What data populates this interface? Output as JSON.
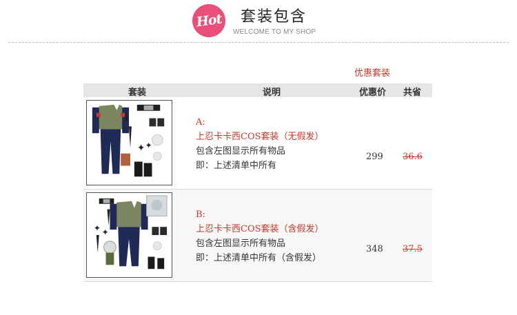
{
  "header": {
    "badge_text": "Hot",
    "title": "套装包含",
    "subtitle": "WELCOME TO MY SHOP"
  },
  "promo_label": "优惠套装",
  "table": {
    "columns": [
      "套装",
      "说明",
      "优惠价",
      "共省"
    ],
    "rows": [
      {
        "option": "A:",
        "name": "上忍卡卡西COS套装（无假发）",
        "line1": "包含左图显示所有物品",
        "line2": "即：上述清单中所有",
        "price": "299",
        "saving": "36.6"
      },
      {
        "option": "B:",
        "name": "上忍卡卡西COS套装（含假发）",
        "line1": "包含左图显示所有物品",
        "line2": "即：上述清单中所有（含假发）",
        "price": "348",
        "saving": "37.5"
      }
    ]
  },
  "colors": {
    "accent_red": "#c0392b",
    "badge_pink": "#e8507a",
    "header_bg": "#e6e6e6"
  }
}
